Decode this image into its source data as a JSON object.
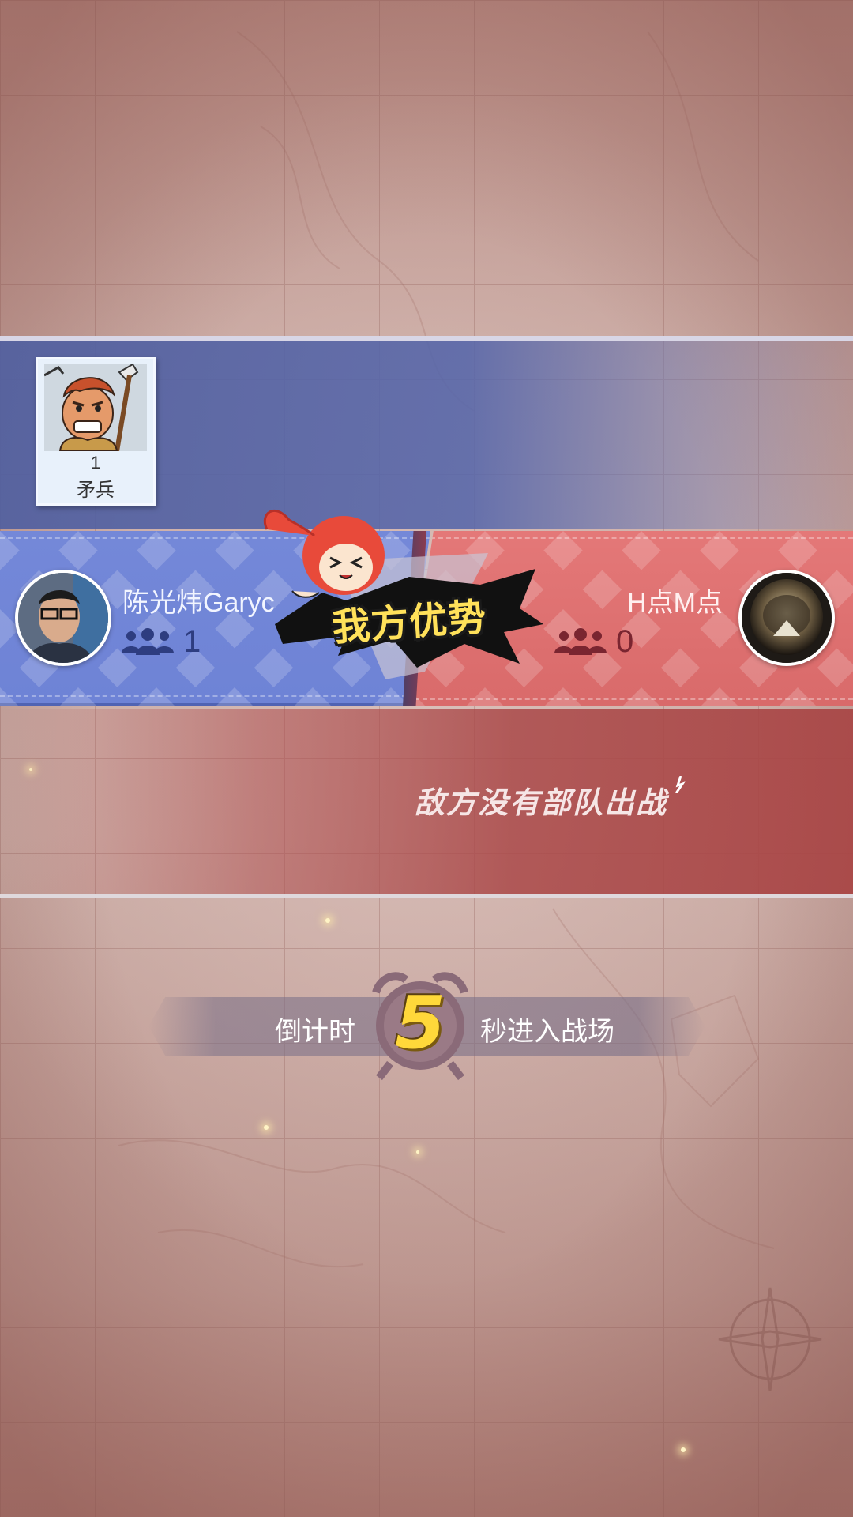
{
  "unit_panel": {
    "count": "1",
    "name": "矛兵"
  },
  "players": {
    "left": {
      "name": "陈光炜Garyc",
      "troops": "1"
    },
    "right": {
      "name": "H点M点",
      "troops": "0"
    }
  },
  "banner": {
    "text": "我方优势"
  },
  "message": {
    "text": "敌方没有部队出战"
  },
  "countdown": {
    "prefix": "倒计时",
    "seconds": "5",
    "suffix": "秒进入战场"
  },
  "colors": {
    "team_blue": "#6e83d6",
    "team_red": "#d96a6a",
    "badge_yellow": "#ffe15a"
  },
  "icons": [
    "troops-icon",
    "alarm-clock-icon",
    "compass-icon"
  ]
}
